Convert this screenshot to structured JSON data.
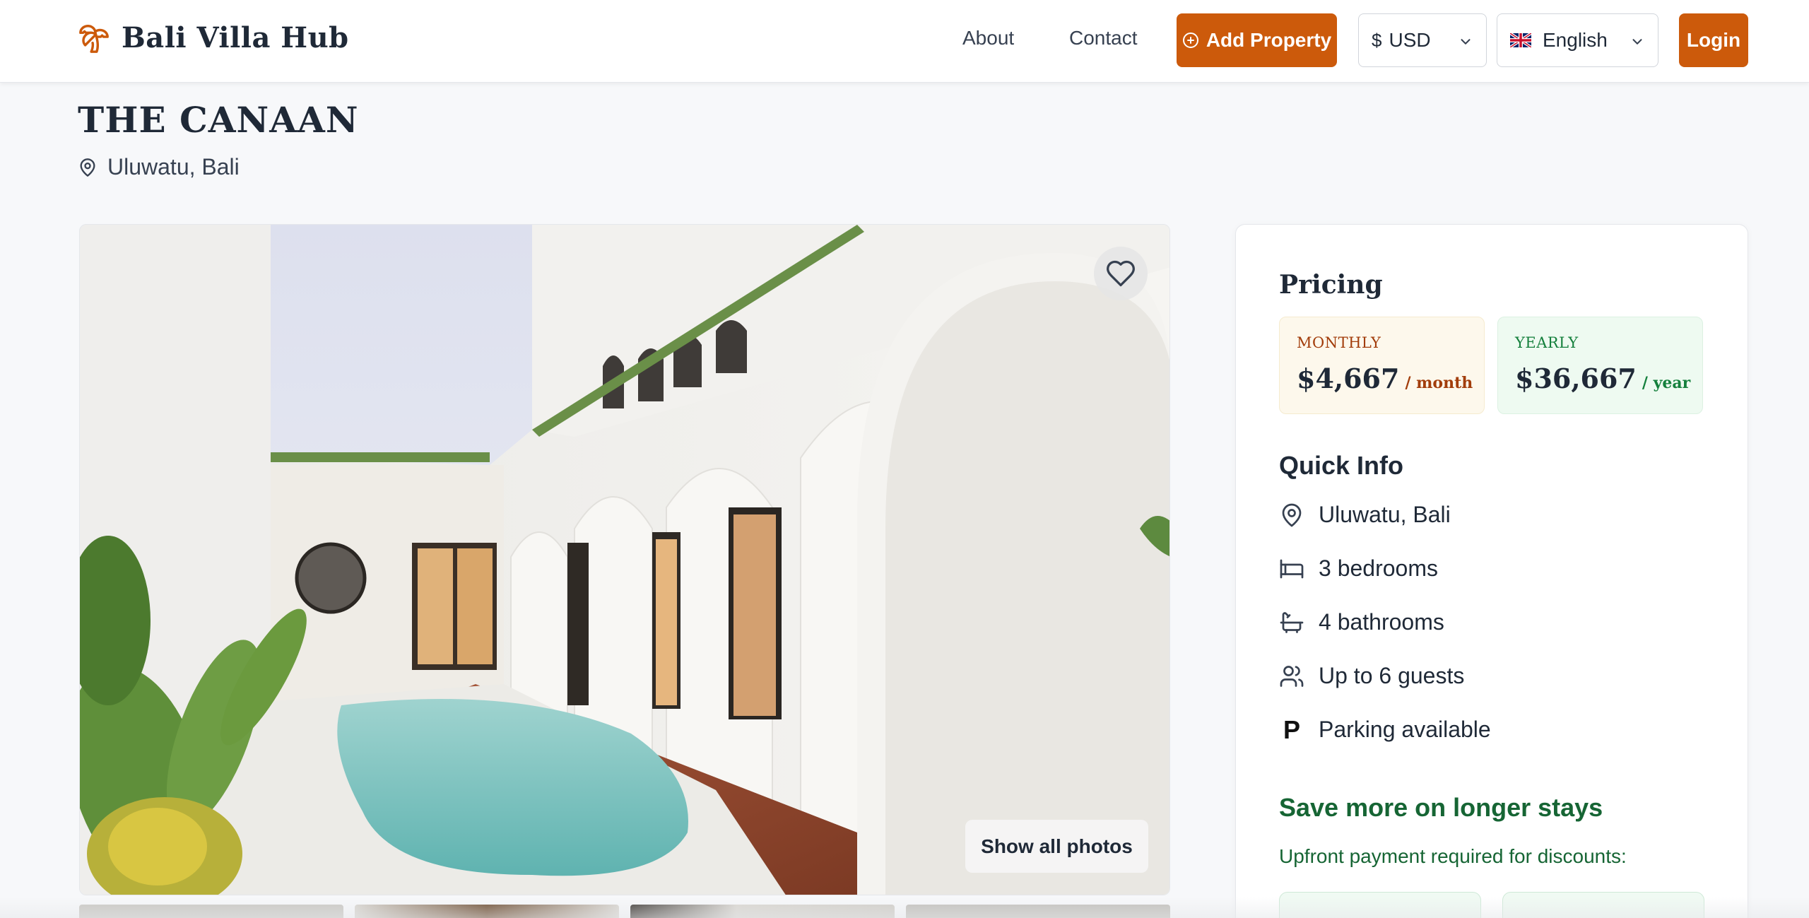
{
  "header": {
    "brand": "Bali Villa Hub",
    "nav": {
      "about": "About",
      "contact": "Contact"
    },
    "add_property": "Add Property",
    "currency": {
      "symbol": "$",
      "value": "USD"
    },
    "language": {
      "value": "English"
    },
    "login": "Login"
  },
  "property": {
    "title": "THE CANAAN",
    "location": "Uluwatu, Bali"
  },
  "gallery": {
    "show_all": "Show all photos"
  },
  "pricing": {
    "heading": "Pricing",
    "monthly": {
      "label": "MONTHLY",
      "price": "$4,667",
      "unit": "/ month"
    },
    "yearly": {
      "label": "YEARLY",
      "price": "$36,667",
      "unit": "/ year"
    }
  },
  "quick_info": {
    "heading": "Quick Info",
    "location": "Uluwatu, Bali",
    "bedrooms": "3 bedrooms",
    "bathrooms": "4 bathrooms",
    "guests": "Up to 6 guests",
    "parking": "Parking available"
  },
  "discounts": {
    "heading": "Save more on longer stays",
    "subtitle": "Upfront payment required for discounts:"
  },
  "colors": {
    "accent": "#cc5a0b",
    "green": "#166534",
    "monthly_bg": "#fdf8ec",
    "yearly_bg": "#eefaf1"
  },
  "icons": {
    "logo": "palm-tree-icon",
    "add": "plus-circle-icon",
    "location": "map-pin-icon",
    "favorite": "heart-icon",
    "bed": "bed-icon",
    "bath": "bathtub-icon",
    "guests": "users-icon",
    "parking": "parking-icon"
  }
}
